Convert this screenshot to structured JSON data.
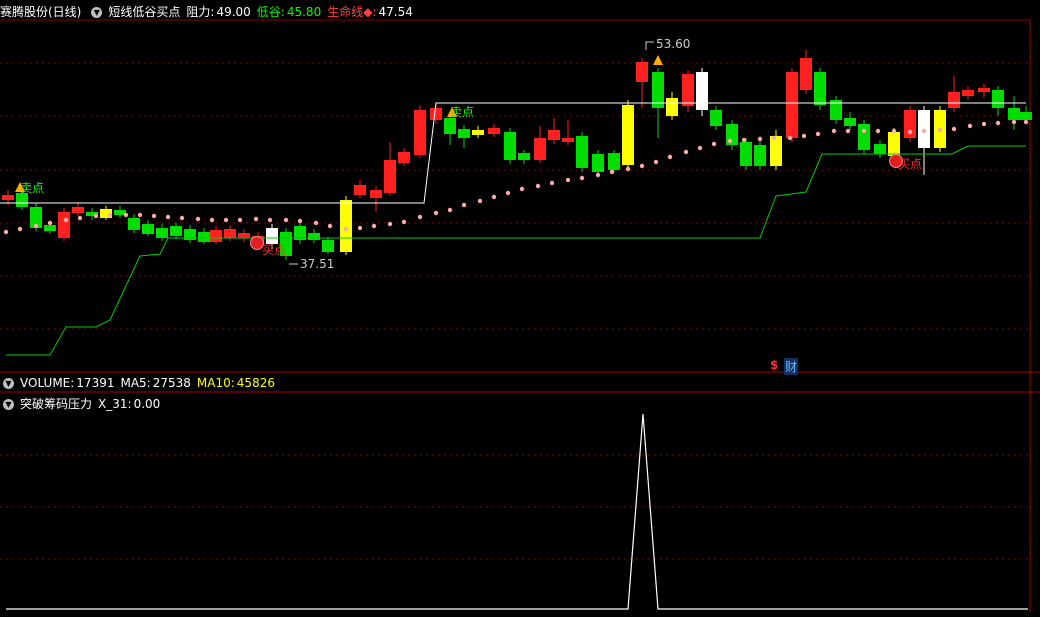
{
  "header": {
    "stock": "赛腾股份(日线)",
    "indicator": "短线低谷买点",
    "resistance_label": "阻力:",
    "resistance_value": "49.00",
    "valley_label": "低谷:",
    "valley_value": "45.80",
    "lifeline_label": "生命线◆:",
    "lifeline_value": "47.54"
  },
  "volume_header": {
    "name": "VOLUME:",
    "value": "17391",
    "ma5_label": "MA5:",
    "ma5_value": "27538",
    "ma10_label": "MA10:",
    "ma10_value": "45826"
  },
  "indicator_header": {
    "name": "突破筹码压力",
    "x_label": "X_31:",
    "x_value": "0.00"
  },
  "annotations": {
    "high": "53.60",
    "low": "37.51",
    "sell1": "卖点",
    "sell2": "卖点",
    "buy1": "买点",
    "buy2": "买点",
    "cai_icon": "财",
    "dollar": "$"
  },
  "colors": {
    "up": "#ff2020",
    "down": "#00dd00",
    "resistance": "#ffffff",
    "support": "#00cc00",
    "dots": "#ffaaaa",
    "grid": "#8b0000",
    "highlight": "#ffff00"
  },
  "chart_data": {
    "type": "candlestick",
    "ylim": [
      33,
      57
    ],
    "high_point": 53.6,
    "low_point": 37.51,
    "indicator_series": {
      "name": "X_31",
      "peak_value": 1,
      "last_value": 0.0
    }
  }
}
